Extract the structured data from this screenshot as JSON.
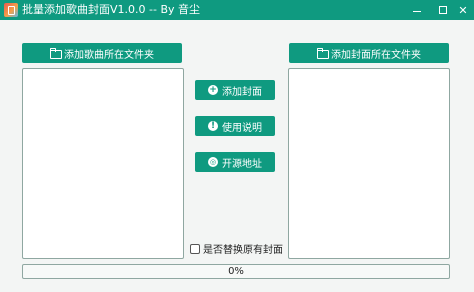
{
  "window": {
    "title": "批量添加歌曲封面V1.0.0 -- By 音尘",
    "minimize": "—",
    "maximize": "□",
    "close": "✕"
  },
  "left": {
    "button_label": "添加歌曲所在文件夹",
    "icon": "folder-open-icon"
  },
  "right": {
    "button_label": "添加封面所在文件夹",
    "icon": "folder-open-icon"
  },
  "actions": {
    "add_cover": {
      "label": "添加封面",
      "glyph": "+",
      "icon": "plus-circle-icon"
    },
    "usage": {
      "label": "使用说明",
      "glyph": "!",
      "icon": "info-circle-icon"
    },
    "source": {
      "label": "开源地址",
      "glyph": "◎",
      "icon": "github-icon"
    }
  },
  "options": {
    "replace_cover_label": "是否替换原有封面",
    "replace_cover_checked": false
  },
  "progress": {
    "text": "0%",
    "value": 0
  },
  "colors": {
    "accent": "#0f9a80",
    "background": "#f3f5f4",
    "border": "#8fa7a1"
  }
}
